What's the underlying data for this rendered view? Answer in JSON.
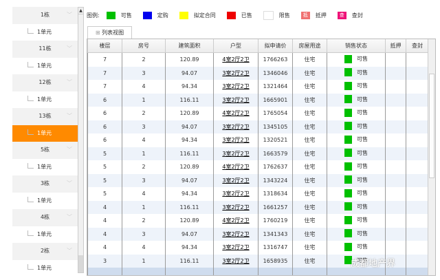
{
  "sidebar": {
    "items": [
      {
        "label": "1栋",
        "type": "b"
      },
      {
        "label": "1单元",
        "type": "u"
      },
      {
        "label": "11栋",
        "type": "b"
      },
      {
        "label": "1单元",
        "type": "u"
      },
      {
        "label": "12栋",
        "type": "b"
      },
      {
        "label": "1单元",
        "type": "u"
      },
      {
        "label": "13栋",
        "type": "b"
      },
      {
        "label": "1单元",
        "type": "u",
        "selected": true
      },
      {
        "label": "5栋",
        "type": "b"
      },
      {
        "label": "1单元",
        "type": "u"
      },
      {
        "label": "3栋",
        "type": "b"
      },
      {
        "label": "1单元",
        "type": "u"
      },
      {
        "label": "4栋",
        "type": "b"
      },
      {
        "label": "1单元",
        "type": "u"
      },
      {
        "label": "2栋",
        "type": "b"
      },
      {
        "label": "1单元",
        "type": "u"
      }
    ]
  },
  "legend": {
    "title": "图例:",
    "items": [
      {
        "label": "可售",
        "color": "#00c000",
        "glyph": ""
      },
      {
        "label": "定购",
        "color": "#0000ee",
        "glyph": ""
      },
      {
        "label": "拟定合同",
        "color": "#ffff00",
        "glyph": ""
      },
      {
        "label": "已售",
        "color": "#ee0000",
        "glyph": ""
      },
      {
        "label": "限售",
        "color": "#ffffff",
        "glyph": ""
      },
      {
        "label": "抵押",
        "color": "#f07070",
        "glyph": "抵"
      },
      {
        "label": "查封",
        "color": "#ee1177",
        "glyph": "查"
      }
    ]
  },
  "tab": {
    "label": "列表视图"
  },
  "table": {
    "headers": [
      "楼层",
      "房号",
      "建筑面积",
      "户型",
      "拟申请价",
      "房屋用途",
      "销售状态",
      "抵押",
      "查封"
    ],
    "rows": [
      [
        "7",
        "2",
        "120.89",
        "4室2厅2卫",
        "1766263",
        "住宅",
        "可售"
      ],
      [
        "7",
        "3",
        "94.07",
        "3室2厅2卫",
        "1346046",
        "住宅",
        "可售"
      ],
      [
        "7",
        "4",
        "94.34",
        "3室2厅2卫",
        "1321464",
        "住宅",
        "可售"
      ],
      [
        "6",
        "1",
        "116.11",
        "3室2厅2卫",
        "1665901",
        "住宅",
        "可售"
      ],
      [
        "6",
        "2",
        "120.89",
        "4室2厅2卫",
        "1765054",
        "住宅",
        "可售"
      ],
      [
        "6",
        "3",
        "94.07",
        "3室2厅2卫",
        "1345105",
        "住宅",
        "可售"
      ],
      [
        "6",
        "4",
        "94.34",
        "3室2厅2卫",
        "1320521",
        "住宅",
        "可售"
      ],
      [
        "5",
        "1",
        "116.11",
        "3室2厅2卫",
        "1663579",
        "住宅",
        "可售"
      ],
      [
        "5",
        "2",
        "120.89",
        "4室2厅2卫",
        "1762637",
        "住宅",
        "可售"
      ],
      [
        "5",
        "3",
        "94.07",
        "3室2厅2卫",
        "1343224",
        "住宅",
        "可售"
      ],
      [
        "5",
        "4",
        "94.34",
        "3室2厅2卫",
        "1318634",
        "住宅",
        "可售"
      ],
      [
        "4",
        "1",
        "116.11",
        "3室2厅2卫",
        "1661257",
        "住宅",
        "可售"
      ],
      [
        "4",
        "2",
        "120.89",
        "4室2厅2卫",
        "1760219",
        "住宅",
        "可售"
      ],
      [
        "4",
        "3",
        "94.07",
        "3室2厅2卫",
        "1341343",
        "住宅",
        "可售"
      ],
      [
        "4",
        "4",
        "94.34",
        "3室2厅2卫",
        "1316747",
        "住宅",
        "可售"
      ],
      [
        "3",
        "1",
        "116.11",
        "3室2厅2卫",
        "1658935",
        "住宅",
        "可售"
      ]
    ]
  },
  "watermark": "成都地产界"
}
